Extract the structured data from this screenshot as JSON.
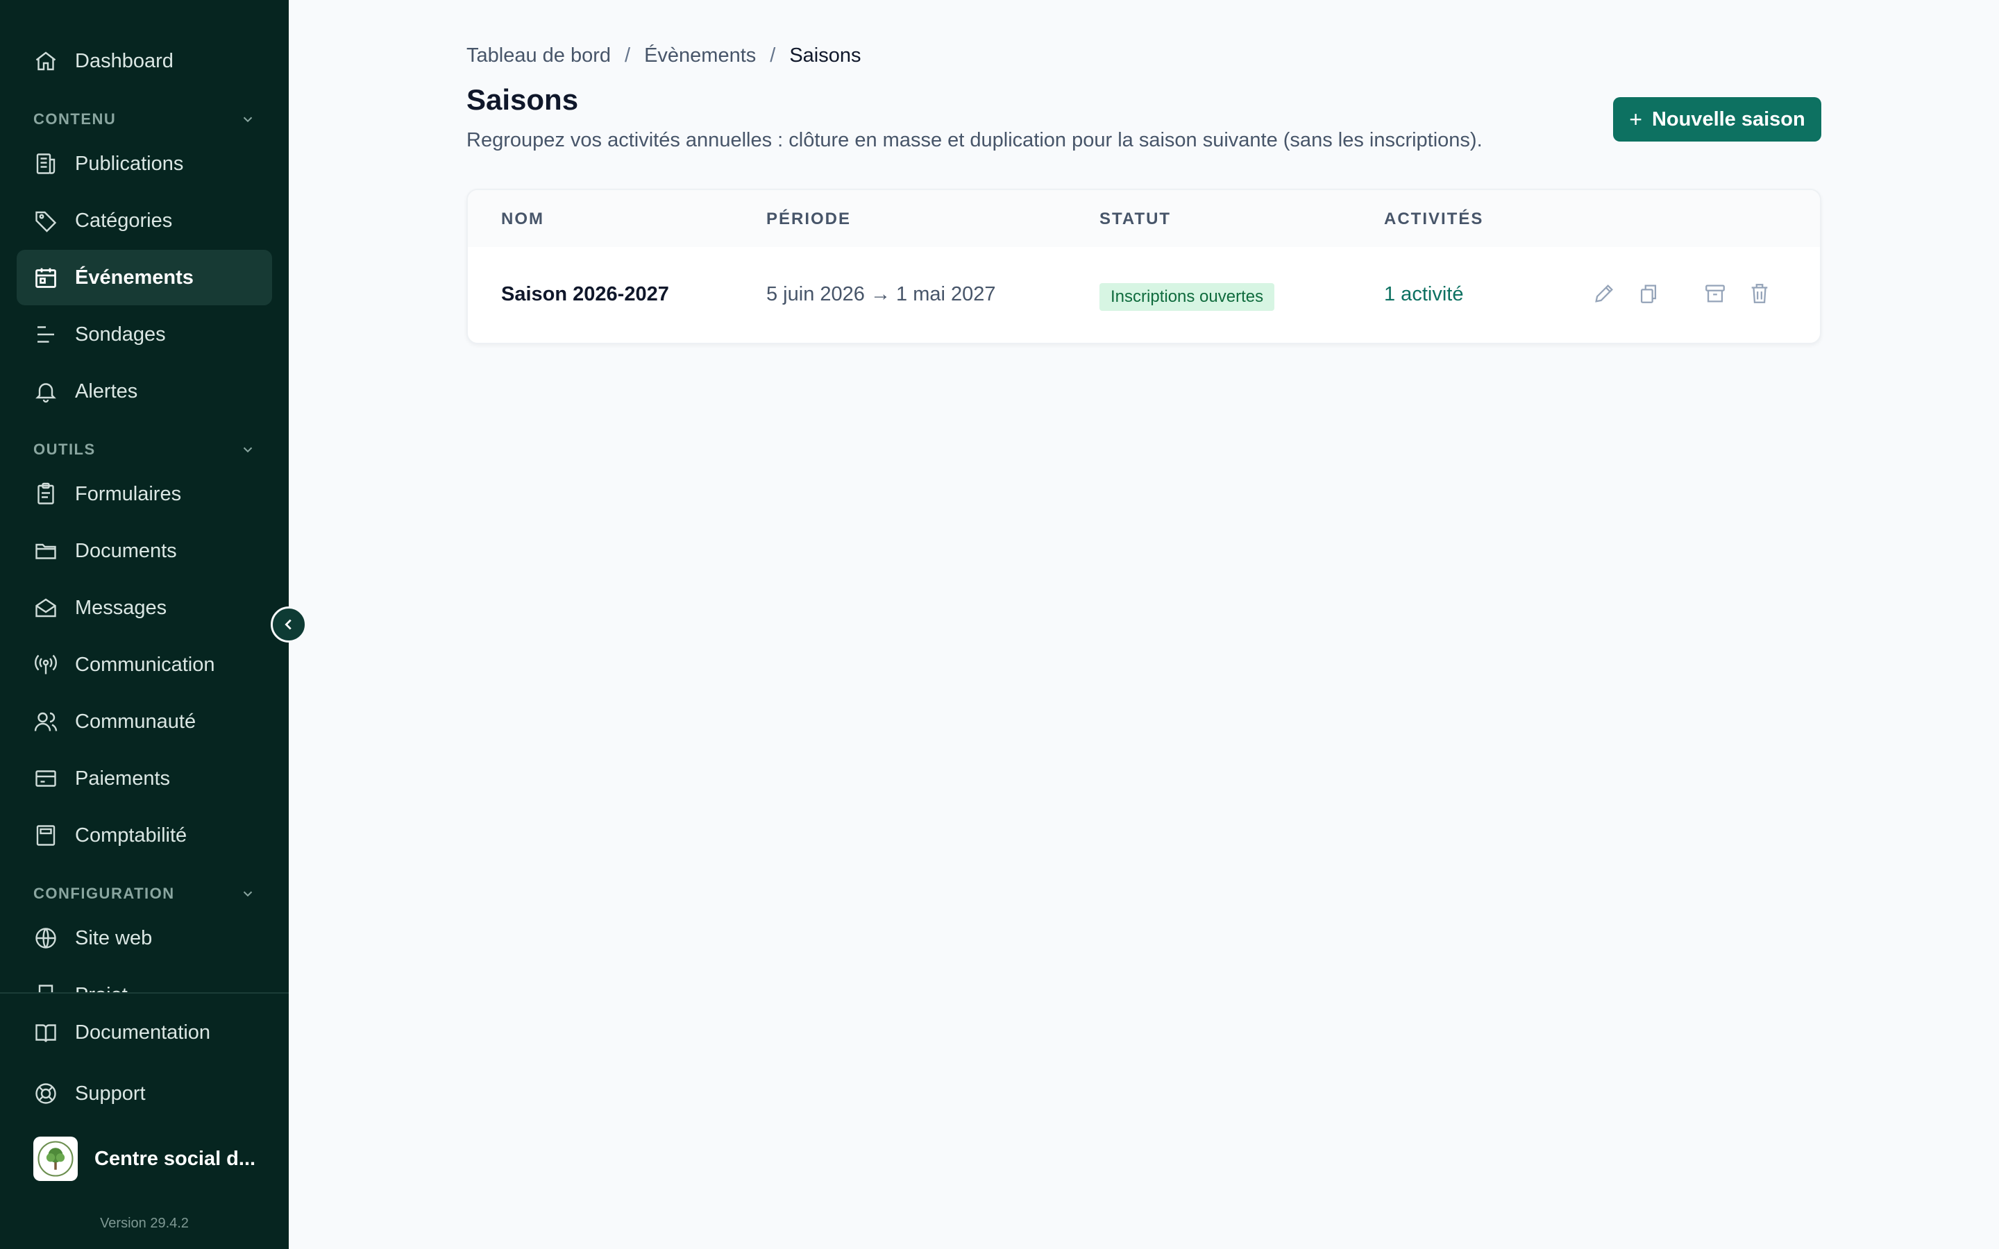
{
  "sidebar": {
    "dashboard": "Dashboard",
    "sections": {
      "contenu": "CONTENU",
      "outils": "OUTILS",
      "configuration": "CONFIGURATION"
    },
    "items": {
      "publications": "Publications",
      "categories": "Catégories",
      "evenements": "Événements",
      "sondages": "Sondages",
      "alertes": "Alertes",
      "formulaires": "Formulaires",
      "documents": "Documents",
      "messages": "Messages",
      "communication": "Communication",
      "communaute": "Communauté",
      "paiements": "Paiements",
      "comptabilite": "Comptabilité",
      "site_web": "Site web",
      "projet": "Projet"
    },
    "footer": {
      "documentation": "Documentation",
      "support": "Support",
      "org_name": "Centre social d...",
      "version": "Version 29.4.2"
    },
    "active_item": "evenements"
  },
  "breadcrumb": {
    "home": "Tableau de bord",
    "events": "Évènements",
    "current": "Saisons",
    "separator": "/"
  },
  "page": {
    "title": "Saisons",
    "description": "Regroupez vos activités annuelles : clôture en masse et duplication pour la saison suivante (sans les inscriptions).",
    "new_button": "Nouvelle saison"
  },
  "table": {
    "columns": [
      "NOM",
      "PÉRIODE",
      "STATUT",
      "ACTIVITÉS"
    ],
    "rows": [
      {
        "name": "Saison 2026-2027",
        "period": "5 juin 2026 → 1 mai 2027",
        "status": "Inscriptions ouvertes",
        "activities": "1 activité"
      }
    ]
  },
  "colors": {
    "sidebar_bg": "#062520",
    "accent": "#0d7161",
    "badge_bg": "#d7f5e3",
    "badge_text": "#0f6b3d"
  },
  "icons": {
    "row_actions": [
      "pencil-icon",
      "copy-icon",
      "archive-icon",
      "trash-icon"
    ]
  }
}
